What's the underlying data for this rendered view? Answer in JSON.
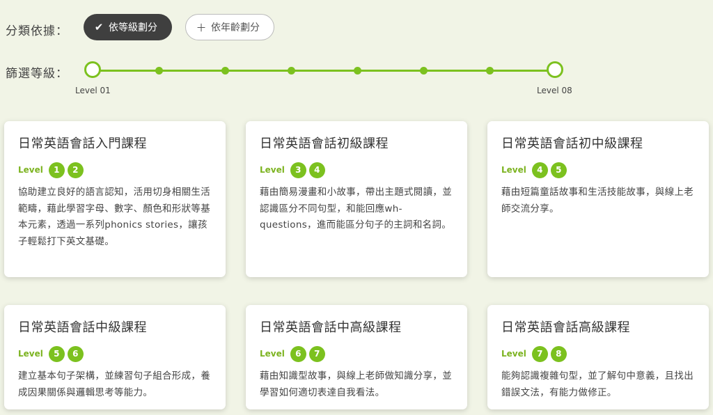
{
  "filter": {
    "label": "分類依據：",
    "options": [
      {
        "label": "依等級劃分",
        "icon": "check-icon",
        "active": true
      },
      {
        "label": "依年齡劃分",
        "icon": "plus-icon",
        "active": false
      }
    ]
  },
  "level_filter": {
    "label": "篩選等級：",
    "min_label": "Level 01",
    "max_label": "Level 08",
    "range": [
      1,
      8
    ],
    "selected": [
      1,
      8
    ]
  },
  "courses": [
    {
      "title": "日常英語會話入門課程",
      "level_word": "Level",
      "levels": [
        "1",
        "2"
      ],
      "description": "協助建立良好的語言認知，活用切身相關生活範疇，藉此學習字母、數字、顏色和形狀等基本元素，透過一系列phonics stories，讓孩子輕鬆打下英文基礎。"
    },
    {
      "title": "日常英語會話初級課程",
      "level_word": "Level",
      "levels": [
        "3",
        "4"
      ],
      "description": "藉由簡易漫畫和小故事，帶出主題式閱讀，並認識區分不同句型，和能回應wh-questions，進而能區分句子的主詞和名詞。"
    },
    {
      "title": "日常英語會話初中級課程",
      "level_word": "Level",
      "levels": [
        "4",
        "5"
      ],
      "description": "藉由短篇童話故事和生活技能故事，與線上老師交流分享。"
    },
    {
      "title": "日常英語會話中級課程",
      "level_word": "Level",
      "levels": [
        "5",
        "6"
      ],
      "description": "建立基本句子架構，並練習句子組合形成，養成因果關係與邏輯思考等能力。"
    },
    {
      "title": "日常英語會話中高級課程",
      "level_word": "Level",
      "levels": [
        "6",
        "7"
      ],
      "description": "藉由知識型故事，與線上老師做知識分享，並學習如何適切表達自我看法。"
    },
    {
      "title": "日常英語會話高級課程",
      "level_word": "Level",
      "levels": [
        "7",
        "8"
      ],
      "description": "能夠認識複雜句型，並了解句中意義，且找出錯誤文法，有能力做修正。"
    }
  ],
  "colors": {
    "accent": "#7cc11f",
    "active_pill": "#3f3f3f",
    "background": "#f1f4e6"
  }
}
